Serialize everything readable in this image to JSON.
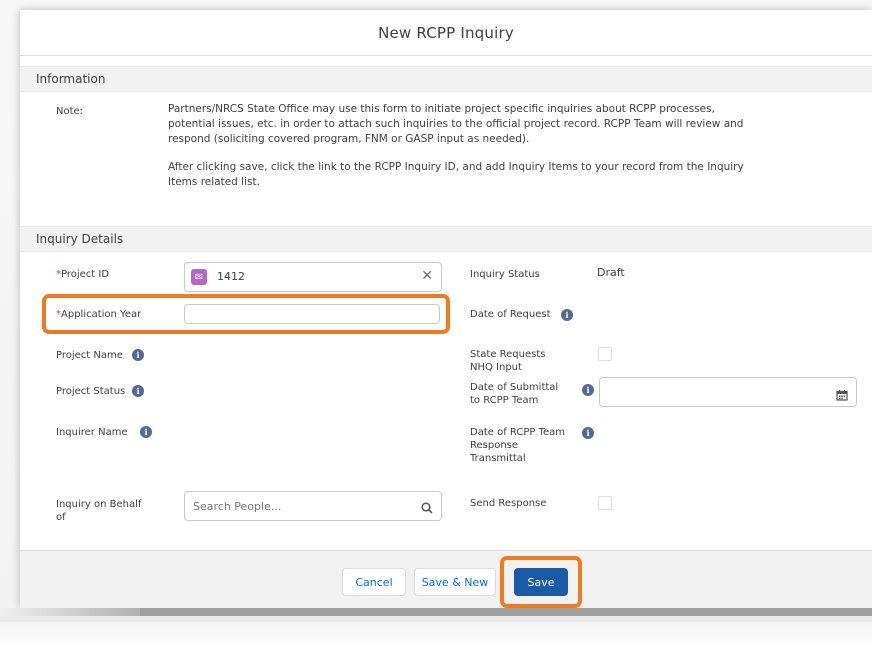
{
  "modal": {
    "title": "New RCPP Inquiry"
  },
  "sections": {
    "information": "Information",
    "inquiry_details": "Inquiry Details"
  },
  "note": {
    "label": "Note:",
    "paragraph1_line1": "Partners/NRCS State Office may use this form to initiate project specific inquiries about RCPP processes,",
    "paragraph1_line2": "potential issues, etc. in order to attach such inquiries to the official project record. RCPP Team will review and",
    "paragraph1_line3": "respond (soliciting covered program, FNM or GASP input as needed).",
    "paragraph2_line1": "After clicking save, click the link to the RCPP Inquiry ID, and add Inquiry Items to your record from the Inquiry",
    "paragraph2_line2": "Items related list."
  },
  "fields": {
    "project_id": {
      "required_mark": "*",
      "label": "Project ID",
      "value": "1412",
      "icon": "envelope-icon",
      "clear_icon": "close-icon"
    },
    "application_year": {
      "required_mark": "*",
      "label": "Application Year",
      "value": ""
    },
    "project_name": {
      "label": "Project Name"
    },
    "project_status": {
      "label": "Project Status"
    },
    "inquirer_name": {
      "label": "Inquirer Name"
    },
    "inquiry_on_behalf": {
      "label_line1": "Inquiry on Behalf",
      "label_line2": "of",
      "placeholder": "Search People...",
      "icon": "search-icon"
    },
    "inquiry_status": {
      "label": "Inquiry Status",
      "value": "Draft"
    },
    "date_of_request": {
      "label": "Date of Request"
    },
    "state_requests": {
      "label_line1": "State Requests",
      "label_line2": "NHQ Input",
      "checked": false
    },
    "date_of_submittal": {
      "label_line1": "Date of Submittal",
      "label_line2": "to RCPP Team",
      "icon": "calendar-icon"
    },
    "date_of_response": {
      "label_line1": "Date of RCPP Team",
      "label_line2": "Response",
      "label_line3": "Transmittal"
    },
    "send_response": {
      "label": "Send Response",
      "checked": false
    }
  },
  "footer": {
    "cancel_label": "Cancel",
    "save_new_label": "Save & New",
    "save_label": "Save"
  },
  "colors": {
    "highlight": "#ee7b1f",
    "primary_button": "#1a5aa8",
    "link": "#0070d2",
    "required": "#c23934",
    "lookup_icon": "#b168c6"
  }
}
